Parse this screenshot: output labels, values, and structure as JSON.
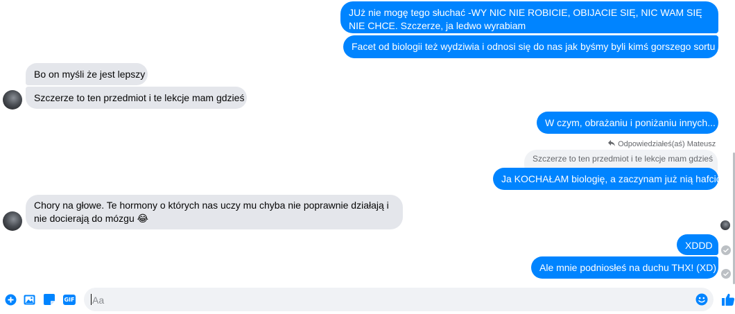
{
  "messages": [
    {
      "id": "m1",
      "side": "out",
      "text": "JUż nie mogę tego słuchać -WY NIC NIE ROBICIE, OBIJACIE SIĘ, NIC WAM SIĘ NIE CHCE.  Szczerze, ja ledwo wyrabiam"
    },
    {
      "id": "m2",
      "side": "out",
      "text": "Facet od biologii też wydziwia i odnosi się do nas jak byśmy byli kimś gorszego sortu"
    },
    {
      "id": "m3",
      "side": "in",
      "text": "Bo on myśli że jest lepszy"
    },
    {
      "id": "m4",
      "side": "in",
      "text": "Szczerze to ten przedmiot i te lekcje mam gdzieś"
    },
    {
      "id": "m5",
      "side": "out",
      "text": "W czym, obrażaniu i poniżaniu innych..."
    },
    {
      "id": "m6",
      "side": "out",
      "text": "Ja KOCHAŁAM biologię, a zaczynam już nią hafcić"
    },
    {
      "id": "m7",
      "side": "in",
      "text": "Chory na głowe. Te hormony o których nas uczy mu chyba nie poprawnie działają i nie docierają do mózgu 😂"
    },
    {
      "id": "m8",
      "side": "out",
      "text": "XDDD"
    },
    {
      "id": "m9",
      "side": "out",
      "text": "Ale mnie podniosłeś na duchu THX! (XD)"
    }
  ],
  "reply": {
    "note": "Odpowiedziałeś(aś) Mateusz",
    "quoted_text": "Szczerze to ten przedmiot i te lekcje mam gdzieś"
  },
  "composer": {
    "placeholder": "Aa",
    "value": ""
  },
  "icons": {
    "more": "plus-circle-icon",
    "photo": "image-icon",
    "sticker": "sticker-icon",
    "gif": "gif-icon",
    "gif_label": "GIF",
    "emoji": "emoji-icon",
    "like": "thumbs-up-icon"
  },
  "colors": {
    "accent": "#0084ff",
    "incoming_bubble": "#e4e6eb",
    "composer_bg": "#f0f2f5"
  }
}
